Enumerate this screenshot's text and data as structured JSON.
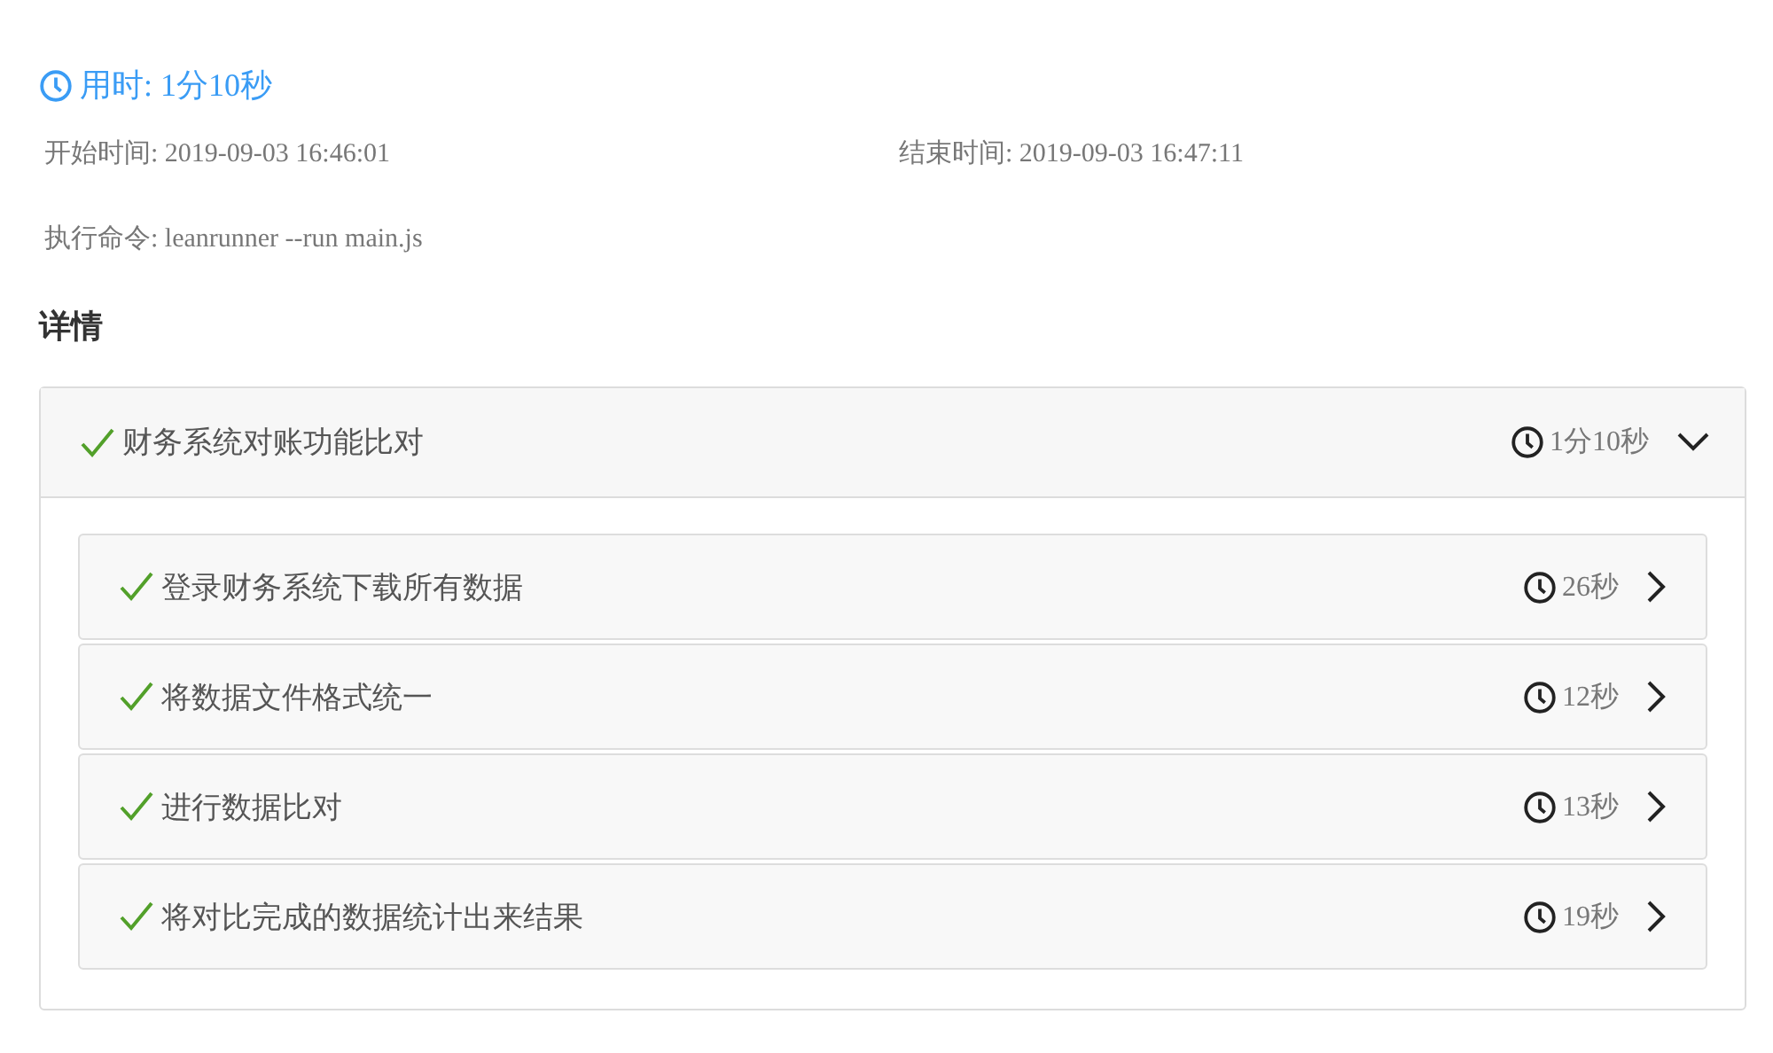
{
  "duration": {
    "label": "用时:",
    "value": "1分10秒"
  },
  "meta": [
    {
      "label": "开始时间:",
      "value": "2019-09-03 16:46:01"
    },
    {
      "label": "结束时间:",
      "value": "2019-09-03 16:47:11"
    },
    {
      "label": "执行命令:",
      "value": "leanrunner --run main.js"
    }
  ],
  "details_title": "详情",
  "suite": {
    "name": "财务系统对账功能比对",
    "passed": true,
    "duration": "1分10秒",
    "expanded": true,
    "steps": [
      {
        "name": "登录财务系统下载所有数据",
        "passed": true,
        "duration": "26秒",
        "expanded": false
      },
      {
        "name": "将数据文件格式统一",
        "passed": true,
        "duration": "12秒",
        "expanded": false
      },
      {
        "name": "进行数据比对",
        "passed": true,
        "duration": "13秒",
        "expanded": false
      },
      {
        "name": "将对比完成的数据统计出来结果",
        "passed": true,
        "duration": "19秒",
        "expanded": false
      }
    ]
  }
}
